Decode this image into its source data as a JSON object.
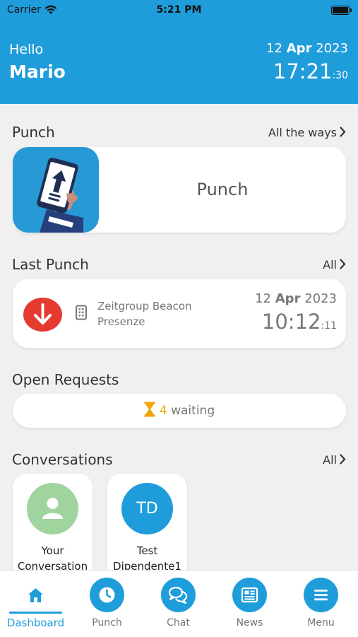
{
  "status_bar": {
    "carrier": "Carrier",
    "time": "5:21 PM"
  },
  "header": {
    "greeting": "Hello",
    "name": "Mario",
    "date_day": "12",
    "date_month": "Apr",
    "date_year": "2023",
    "time_hm": "17:21",
    "time_sec": ":30"
  },
  "punch_section": {
    "title": "Punch",
    "link": "All the ways",
    "card_label": "Punch"
  },
  "last_punch": {
    "title": "Last Punch",
    "link": "All",
    "location_line1": "Zeitgroup Beacon",
    "location_line2": "Presenze",
    "date_day": "12",
    "date_month": "Apr",
    "date_year": "2023",
    "time_hm": "10:12",
    "time_sec": ":11"
  },
  "open_requests": {
    "title": "Open Requests",
    "count": "4",
    "status": "waiting"
  },
  "conversations": {
    "title": "Conversations",
    "link": "All",
    "items": [
      {
        "line1": "Your",
        "line2": "Conversation",
        "avatar": "person-icon",
        "color": "#9fd49f"
      },
      {
        "line1": "Test",
        "line2": "Dipendente1",
        "initials": "TD",
        "color": "#1f9ddb"
      }
    ]
  },
  "tabs": [
    {
      "label": "Dashboard",
      "icon": "home-icon",
      "active": true
    },
    {
      "label": "Punch",
      "icon": "clock-icon"
    },
    {
      "label": "Chat",
      "icon": "chat-icon"
    },
    {
      "label": "News",
      "icon": "news-icon"
    },
    {
      "label": "Menu",
      "icon": "menu-icon"
    }
  ],
  "colors": {
    "accent": "#1f9ddb",
    "punch_out": "#e53a30",
    "waiting": "#f0a500"
  }
}
